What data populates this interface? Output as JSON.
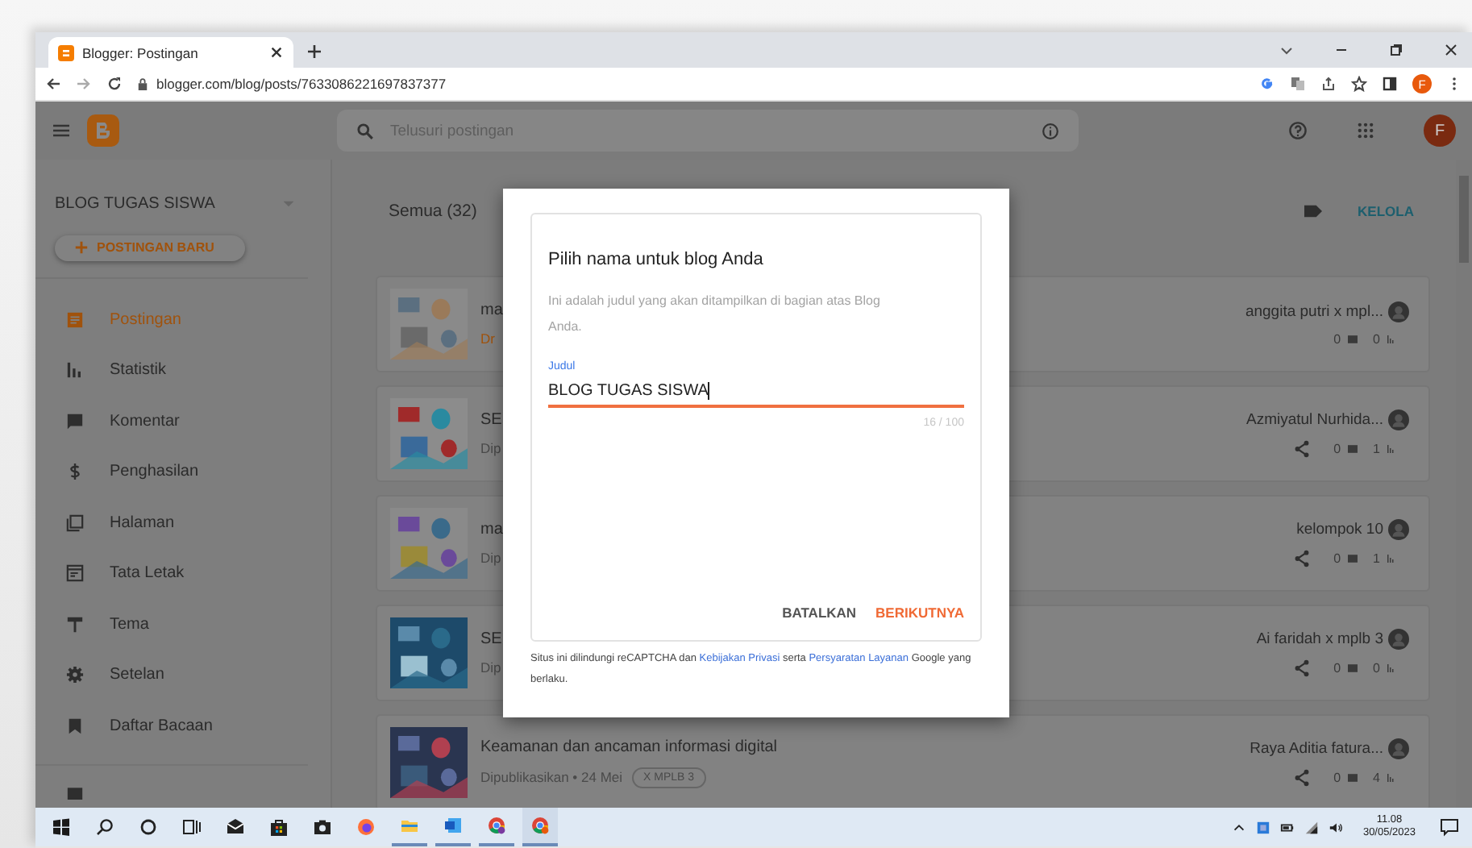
{
  "browser": {
    "tab_title": "Blogger: Postingan",
    "url": "blogger.com/blog/posts/7633086221697837377",
    "profile_initial": "F"
  },
  "app_header": {
    "search_placeholder": "Telusuri postingan",
    "avatar_initial": "F"
  },
  "sidebar": {
    "blog_name": "BLOG TUGAS SISWA",
    "new_post": "POSTINGAN BARU",
    "items": [
      {
        "label": "Postingan",
        "selected": true
      },
      {
        "label": "Statistik",
        "selected": false
      },
      {
        "label": "Komentar",
        "selected": false
      },
      {
        "label": "Penghasilan",
        "selected": false
      },
      {
        "label": "Halaman",
        "selected": false
      },
      {
        "label": "Tata Letak",
        "selected": false
      },
      {
        "label": "Tema",
        "selected": false
      },
      {
        "label": "Setelan",
        "selected": false
      },
      {
        "label": "Daftar Bacaan",
        "selected": false
      }
    ]
  },
  "posts": {
    "filter": "Semua (32)",
    "manage": "KELOLA",
    "items": [
      {
        "title": "ma",
        "status": "Dr",
        "kind": "draft",
        "author": "anggita putri x mpl...",
        "comments": "0",
        "views": "0",
        "shared": false
      },
      {
        "title": "SE",
        "status": "Dip",
        "kind": "published",
        "author": "Azmiyatul Nurhida...",
        "comments": "0",
        "views": "1",
        "shared": true
      },
      {
        "title": "ma",
        "status": "Dip",
        "kind": "published",
        "author": "kelompok 10",
        "comments": "0",
        "views": "1",
        "shared": true
      },
      {
        "title": "SE",
        "status": "Dip",
        "kind": "published",
        "author": "Ai faridah x mplb 3",
        "comments": "0",
        "views": "0",
        "shared": true
      },
      {
        "title": "Keamanan dan ancaman informasi digital",
        "status": "Dipublikasikan • 24 Mei",
        "kind": "published",
        "label": "X MPLB 3",
        "author": "Raya Aditia fatura...",
        "comments": "0",
        "views": "4",
        "shared": true
      }
    ]
  },
  "dialog": {
    "title": "Pilih nama untuk blog Anda",
    "description": "Ini adalah judul yang akan ditampilkan di bagian atas Blog Anda.",
    "field_label": "Judul",
    "value": "BLOG TUGAS SISWA",
    "counter": "16 / 100",
    "cancel": "BATALKAN",
    "next": "BERIKUTNYA",
    "footer": [
      {
        "kind": "text",
        "text": "Situs ini dilindungi reCAPTCHA dan"
      },
      {
        "kind": "link",
        "text": "Kebijakan Privasi"
      },
      {
        "kind": "text",
        "text": "serta"
      },
      {
        "kind": "link",
        "text": "Persyaratan Layanan"
      },
      {
        "kind": "text",
        "text": "Google yang berlaku."
      }
    ]
  },
  "taskbar": {
    "time": "11.08",
    "date": "30/05/2023"
  }
}
